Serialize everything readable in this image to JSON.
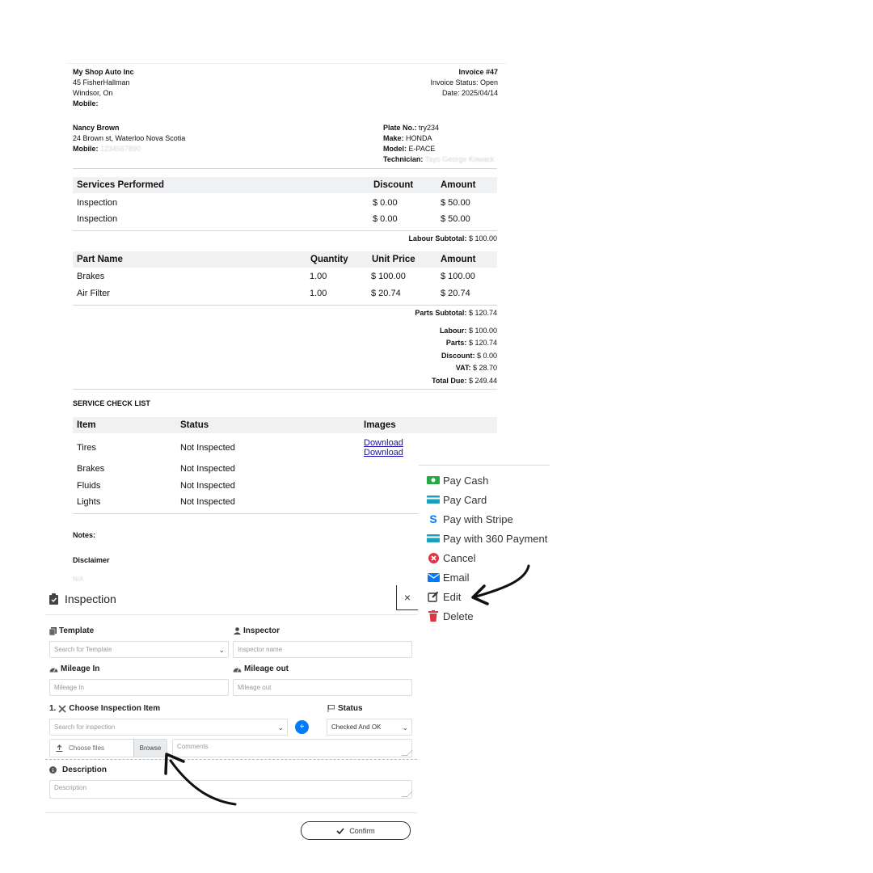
{
  "invoice": {
    "shop": {
      "name": "My Shop Auto Inc",
      "address1": "45 FisherHallman",
      "address2": "Windsor, On",
      "mobile_label": "Mobile:"
    },
    "meta": {
      "number": "Invoice #47",
      "status": "Invoice Status: Open",
      "date": "Date: 2025/04/14"
    },
    "customer": {
      "name": "Nancy Brown",
      "address": "24 Brown st, Waterloo Nova Scotia",
      "mobile_label": "Mobile:",
      "mobile_value": "1234567890"
    },
    "vehicle": {
      "plate_label": "Plate No.:",
      "plate_value": "try234",
      "make_label": "Make:",
      "make_value": "HONDA",
      "model_label": "Model:",
      "model_value": "E-PACE",
      "tech_label": "Technician:",
      "tech_value": "Tayo George Kowack"
    },
    "services": {
      "headers": [
        "Services Performed",
        "Discount",
        "Amount"
      ],
      "rows": [
        [
          "Inspection",
          "$ 0.00",
          "$ 50.00"
        ],
        [
          "Inspection",
          "$ 0.00",
          "$ 50.00"
        ]
      ],
      "subtotal_label": "Labour Subtotal:",
      "subtotal_value": "$ 100.00"
    },
    "parts": {
      "headers": [
        "Part Name",
        "Quantity",
        "Unit Price",
        "Amount"
      ],
      "rows": [
        [
          "Brakes",
          "1.00",
          "$ 100.00",
          "$ 100.00"
        ],
        [
          "Air Filter",
          "1.00",
          "$ 20.74",
          "$ 20.74"
        ]
      ],
      "subtotal_label": "Parts Subtotal:",
      "subtotal_value": "$ 120.74"
    },
    "totals": [
      {
        "label": "Labour:",
        "value": "$ 100.00"
      },
      {
        "label": "Parts:",
        "value": "$ 120.74"
      },
      {
        "label": "Discount:",
        "value": "$ 0.00"
      },
      {
        "label": "VAT:",
        "value": "$ 28.70"
      },
      {
        "label": "Total Due:",
        "value": "$ 249.44"
      }
    ],
    "checklist": {
      "title": "SERVICE CHECK LIST",
      "headers": [
        "Item",
        "Status",
        "Images"
      ],
      "rows": [
        [
          "Tires",
          "Not Inspected"
        ],
        [
          "Brakes",
          "Not Inspected"
        ],
        [
          "Fluids",
          "Not Inspected"
        ],
        [
          "Lights",
          "Not Inspected"
        ]
      ],
      "download_links": [
        "Download",
        "Download"
      ]
    },
    "notes_label": "Notes:",
    "disclaimer_label": "Disclaimer",
    "disclaimer_text": "N/A"
  },
  "menu": {
    "items": [
      {
        "label": "Pay Cash",
        "icon": "cash-icon",
        "color": "#28a745"
      },
      {
        "label": "Pay Card",
        "icon": "card-icon",
        "color": "#17a2b8"
      },
      {
        "label": "Pay with Stripe",
        "icon": "stripe-icon",
        "color": "#007bff"
      },
      {
        "label": "Pay with 360 Payment",
        "icon": "card-icon",
        "color": "#17a2b8"
      },
      {
        "label": "Cancel",
        "icon": "cancel-icon",
        "color": "#dc3545"
      },
      {
        "label": "Email",
        "icon": "envelope-icon",
        "color": "#007bff"
      },
      {
        "label": "Edit",
        "icon": "edit-icon",
        "color": "#333333"
      },
      {
        "label": "Delete",
        "icon": "trash-icon",
        "color": "#dc3545"
      }
    ]
  },
  "modal": {
    "title": "Inspection",
    "close_glyph": "×",
    "template_label": "Template",
    "template_placeholder": "Search for Template",
    "inspector_label": "Inspector",
    "inspector_placeholder": "Inspector name",
    "mileage_in_label": "Mileage In",
    "mileage_in_placeholder": "Mileage In",
    "mileage_out_label": "Mileage out",
    "mileage_out_placeholder": "Mileage out",
    "choose_item_label": "1.",
    "choose_item_text": "Choose Inspection Item",
    "item_placeholder": "Search for inspection",
    "add_glyph": "+",
    "status_label": "Status",
    "status_value": "Checked And OK",
    "choose_files": "Choose files",
    "browse": "Browse",
    "comments_placeholder": "Comments",
    "description_label": "Description",
    "description_placeholder": "Description",
    "confirm": "Confirm"
  },
  "colors": {
    "primary": "#007bff",
    "header_bg": "#f0f1f3"
  }
}
